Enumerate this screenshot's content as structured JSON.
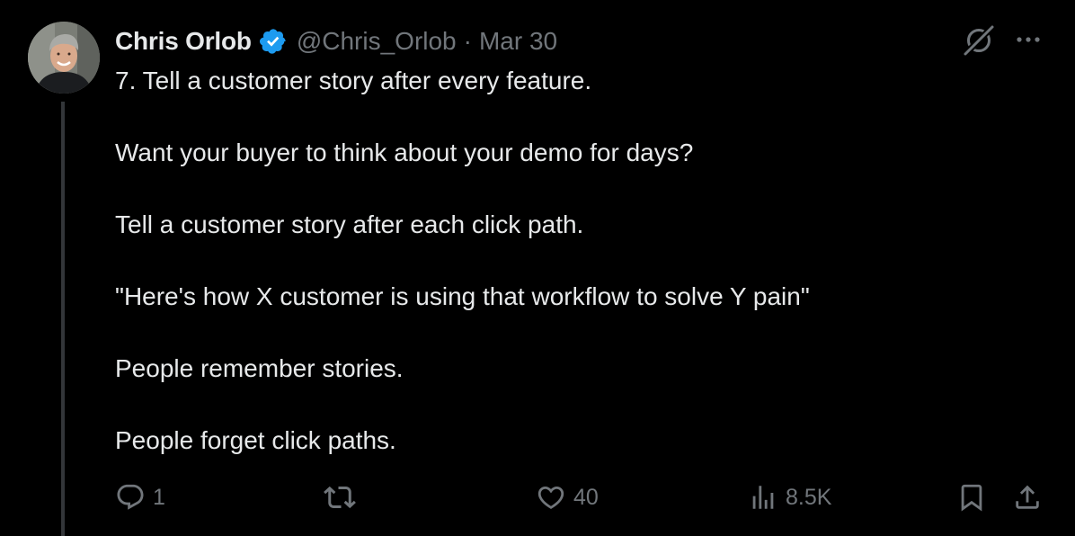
{
  "author": {
    "name": "Chris Orlob",
    "handle": "@Chris_Orlob",
    "separator": "·",
    "date": "Mar 30",
    "verified": true
  },
  "tweet": {
    "lines": [
      "7. Tell a customer story after every feature.",
      "Want your buyer to think about your demo for days?",
      "Tell a customer story after each click path.",
      "\"Here's how X customer is using that workflow to solve Y pain\"",
      "People remember stories.",
      "People forget click paths."
    ]
  },
  "actions": {
    "replies": "1",
    "reposts": "",
    "likes": "40",
    "views": "8.5K"
  },
  "icons": {
    "verified": "verified-badge-icon",
    "grok": "grok-icon",
    "more": "more-icon",
    "reply": "reply-icon",
    "repost": "repost-icon",
    "like": "heart-icon",
    "views": "views-icon",
    "bookmark": "bookmark-icon",
    "share": "share-icon"
  },
  "colors": {
    "background": "#000000",
    "text": "#e7e9ea",
    "muted": "#71767b",
    "verified": "#1d9bf0",
    "thread_line": "#333639"
  }
}
